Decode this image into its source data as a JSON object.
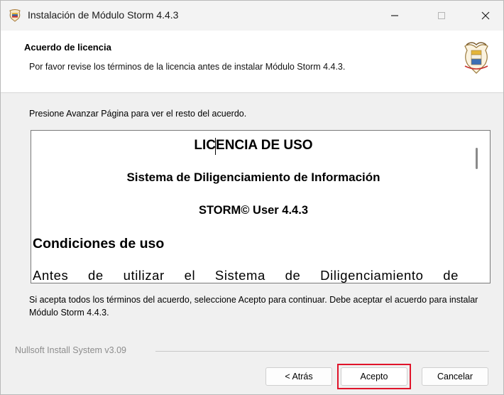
{
  "window": {
    "title": "Instalación de Módulo Storm 4.4.3",
    "controls": {
      "minimize": "—",
      "maximize": "☐",
      "close": "✕"
    }
  },
  "header": {
    "title": "Acuerdo de licencia",
    "subtitle": "Por favor revise los términos de la licencia antes de instalar Módulo Storm 4.4.3."
  },
  "intro_text": "Presione Avanzar Página para ver el resto del acuerdo.",
  "license": {
    "title": "LICENCIA DE USO",
    "subtitle": "Sistema de Diligenciamiento de Información",
    "version": "STORM© User 4.4.3",
    "section_heading": "Condiciones de uso",
    "body_start": "Antes de utilizar el Sistema de Diligenciamiento de"
  },
  "accept_text": "Si acepta todos los términos del acuerdo, seleccione Acepto para continuar. Debe aceptar el acuerdo para instalar Módulo Storm 4.4.3.",
  "branding": "Nullsoft Install System v3.09",
  "buttons": {
    "back": "< Atrás",
    "accept": "Acepto",
    "cancel": "Cancelar"
  },
  "colors": {
    "highlight": "#e0142a",
    "window_bg": "#f0f0f0"
  },
  "icons": {
    "app": "colombia-crest-icon",
    "header": "colombia-crest-icon"
  }
}
